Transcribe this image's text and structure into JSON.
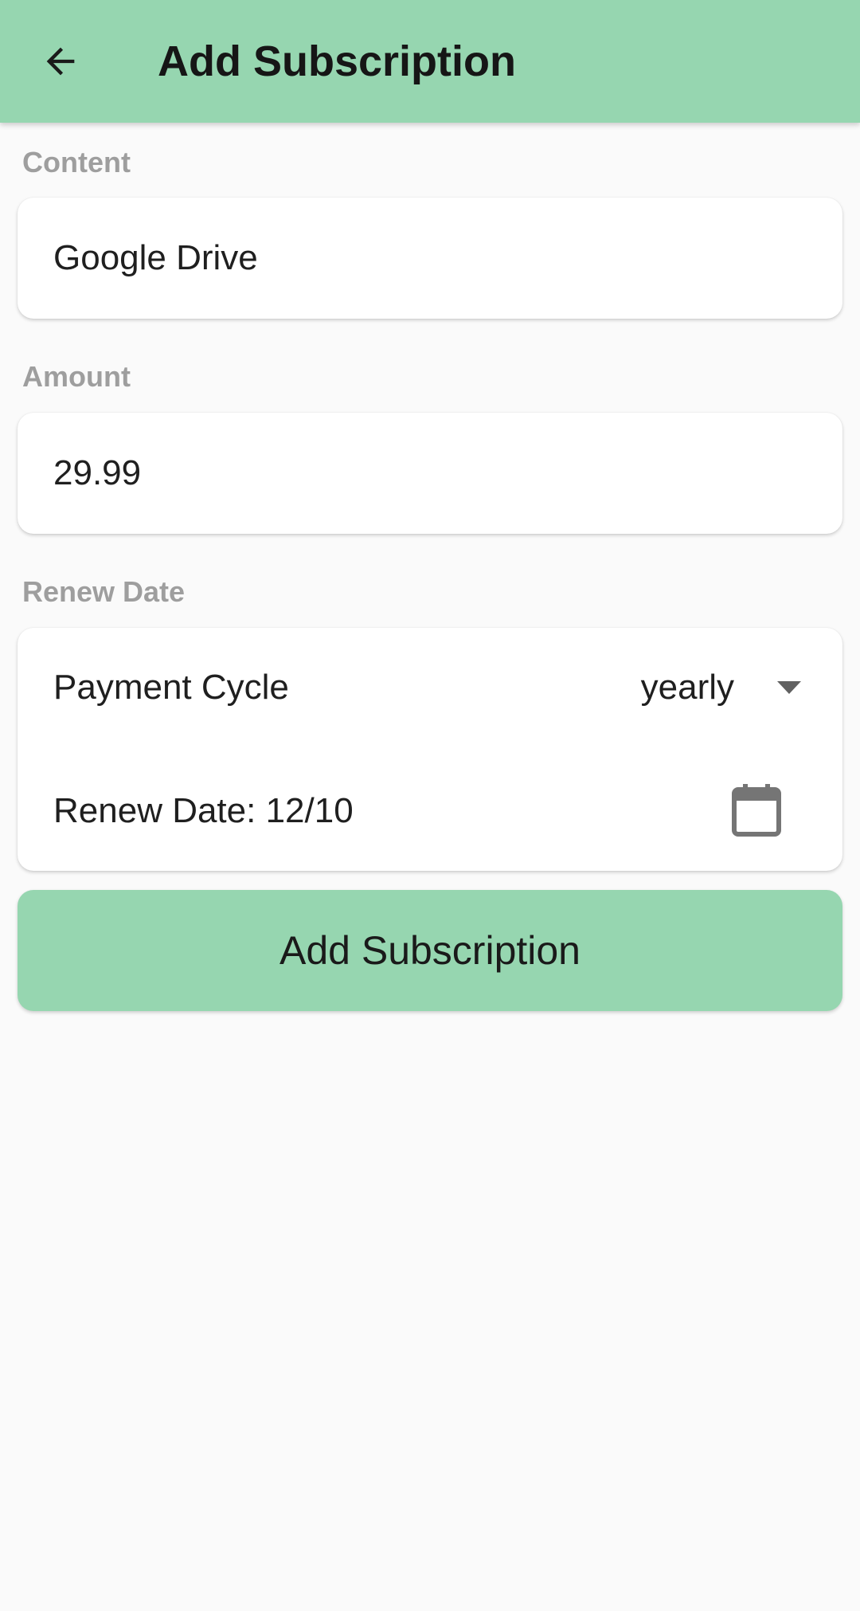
{
  "app_bar": {
    "title": "Add Subscription",
    "back_icon": "arrow-back-icon",
    "background_color": "#96d6b0"
  },
  "form": {
    "content": {
      "label": "Content",
      "value": "Google Drive"
    },
    "amount": {
      "label": "Amount",
      "value": "29.99"
    },
    "renew": {
      "section_label": "Renew Date",
      "payment_cycle_label": "Payment Cycle",
      "payment_cycle_value": "yearly",
      "dropdown_icon": "arrow-drop-down-icon",
      "renew_date_text": "Renew Date: 12/10",
      "calendar_icon": "calendar-icon"
    }
  },
  "actions": {
    "submit_label": "Add Subscription",
    "submit_color": "#96d6b0"
  },
  "colors": {
    "background": "#fafafa",
    "card": "#ffffff",
    "section_label": "#9e9e9e"
  }
}
